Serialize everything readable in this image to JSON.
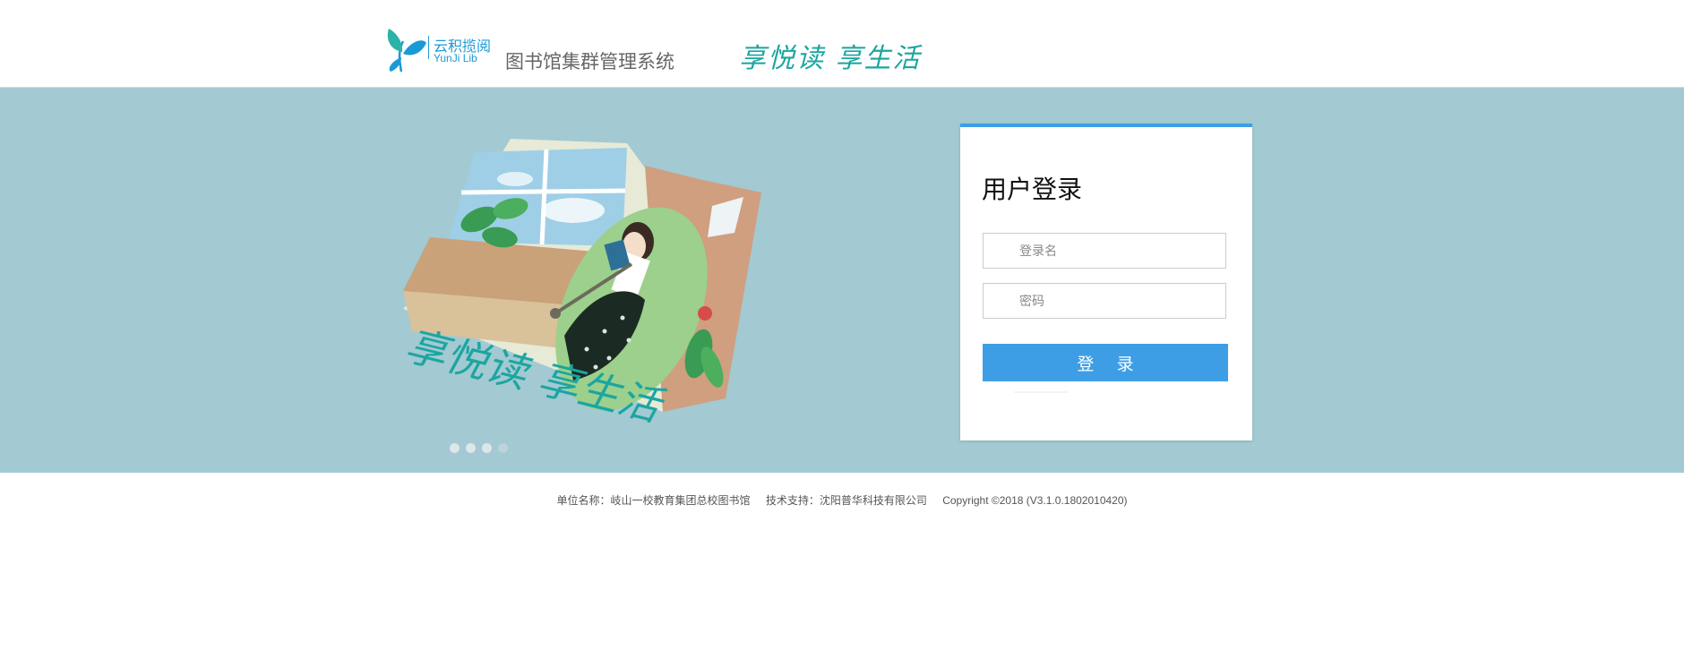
{
  "header": {
    "logo_cn": "云积揽阅",
    "logo_en": "YunJi Lib",
    "system_title": "图书馆集群管理系统",
    "slogan": "享悦读 享生活"
  },
  "banner": {
    "illustration_text": "享悦读 享生活",
    "carousel_dots": 4,
    "active_dot": 1
  },
  "login": {
    "title": "用户登录",
    "username_placeholder": "登录名",
    "password_placeholder": "密码",
    "submit_label": "登 录"
  },
  "footer": {
    "organization": "单位名称：岐山一校教育集团总校图书馆",
    "support": "技术支持：沈阳普华科技有限公司",
    "copyright": "Copyright ©2018 (V3.1.0.1802010420)"
  },
  "colors": {
    "banner_bg": "#a3c9d3",
    "accent_blue": "#3d9ee6",
    "brand_blue": "#1a9ad6",
    "slogan_teal": "#1ba6a0"
  }
}
